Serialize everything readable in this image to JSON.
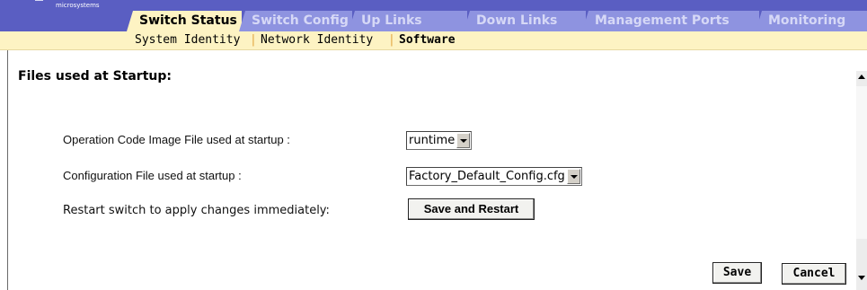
{
  "header": {
    "brand": "microsystems",
    "tabs": [
      {
        "label": "Switch Status",
        "active": true
      },
      {
        "label": "Switch Config",
        "active": false
      },
      {
        "label": "Up Links",
        "active": false
      },
      {
        "label": "Down Links",
        "active": false
      },
      {
        "label": "Management Ports",
        "active": false
      },
      {
        "label": "Monitoring",
        "active": false
      }
    ]
  },
  "subnav": {
    "items": [
      {
        "label": "System Identity",
        "selected": false
      },
      {
        "label": "Network Identity",
        "selected": false
      },
      {
        "label": "Software",
        "selected": true
      }
    ],
    "separator": "|"
  },
  "main": {
    "section_title": "Files used at Startup:",
    "op_code_label": "Operation Code Image File used at startup :",
    "op_code_value": "runtime",
    "config_label": "Configuration File used at startup :",
    "config_value": "Factory_Default_Config.cfg",
    "restart_label": "Restart switch to apply changes immediately:",
    "save_restart_button": "Save and Restart",
    "save_button": "Save",
    "cancel_button": "Cancel"
  },
  "colors": {
    "header_bg": "#5a5ec2",
    "tab_inactive": "#8e93e0",
    "tab_active": "#fdf3c3",
    "subnav_bg": "#fdf3c3",
    "separator": "#e2a640"
  },
  "icons": {
    "dropdown": "chevron-down-icon",
    "scroll_up": "arrow-up-icon",
    "scroll_down": "arrow-down-icon"
  }
}
